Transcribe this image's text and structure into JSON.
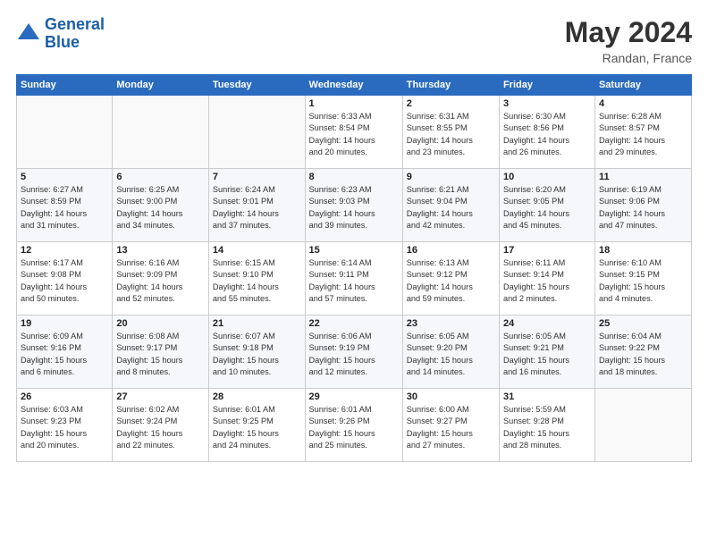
{
  "header": {
    "logo_line1": "General",
    "logo_line2": "Blue",
    "title": "May 2024",
    "subtitle": "Randan, France"
  },
  "weekdays": [
    "Sunday",
    "Monday",
    "Tuesday",
    "Wednesday",
    "Thursday",
    "Friday",
    "Saturday"
  ],
  "weeks": [
    [
      {
        "day": "",
        "info": ""
      },
      {
        "day": "",
        "info": ""
      },
      {
        "day": "",
        "info": ""
      },
      {
        "day": "1",
        "info": "Sunrise: 6:33 AM\nSunset: 8:54 PM\nDaylight: 14 hours\nand 20 minutes."
      },
      {
        "day": "2",
        "info": "Sunrise: 6:31 AM\nSunset: 8:55 PM\nDaylight: 14 hours\nand 23 minutes."
      },
      {
        "day": "3",
        "info": "Sunrise: 6:30 AM\nSunset: 8:56 PM\nDaylight: 14 hours\nand 26 minutes."
      },
      {
        "day": "4",
        "info": "Sunrise: 6:28 AM\nSunset: 8:57 PM\nDaylight: 14 hours\nand 29 minutes."
      }
    ],
    [
      {
        "day": "5",
        "info": "Sunrise: 6:27 AM\nSunset: 8:59 PM\nDaylight: 14 hours\nand 31 minutes."
      },
      {
        "day": "6",
        "info": "Sunrise: 6:25 AM\nSunset: 9:00 PM\nDaylight: 14 hours\nand 34 minutes."
      },
      {
        "day": "7",
        "info": "Sunrise: 6:24 AM\nSunset: 9:01 PM\nDaylight: 14 hours\nand 37 minutes."
      },
      {
        "day": "8",
        "info": "Sunrise: 6:23 AM\nSunset: 9:03 PM\nDaylight: 14 hours\nand 39 minutes."
      },
      {
        "day": "9",
        "info": "Sunrise: 6:21 AM\nSunset: 9:04 PM\nDaylight: 14 hours\nand 42 minutes."
      },
      {
        "day": "10",
        "info": "Sunrise: 6:20 AM\nSunset: 9:05 PM\nDaylight: 14 hours\nand 45 minutes."
      },
      {
        "day": "11",
        "info": "Sunrise: 6:19 AM\nSunset: 9:06 PM\nDaylight: 14 hours\nand 47 minutes."
      }
    ],
    [
      {
        "day": "12",
        "info": "Sunrise: 6:17 AM\nSunset: 9:08 PM\nDaylight: 14 hours\nand 50 minutes."
      },
      {
        "day": "13",
        "info": "Sunrise: 6:16 AM\nSunset: 9:09 PM\nDaylight: 14 hours\nand 52 minutes."
      },
      {
        "day": "14",
        "info": "Sunrise: 6:15 AM\nSunset: 9:10 PM\nDaylight: 14 hours\nand 55 minutes."
      },
      {
        "day": "15",
        "info": "Sunrise: 6:14 AM\nSunset: 9:11 PM\nDaylight: 14 hours\nand 57 minutes."
      },
      {
        "day": "16",
        "info": "Sunrise: 6:13 AM\nSunset: 9:12 PM\nDaylight: 14 hours\nand 59 minutes."
      },
      {
        "day": "17",
        "info": "Sunrise: 6:11 AM\nSunset: 9:14 PM\nDaylight: 15 hours\nand 2 minutes."
      },
      {
        "day": "18",
        "info": "Sunrise: 6:10 AM\nSunset: 9:15 PM\nDaylight: 15 hours\nand 4 minutes."
      }
    ],
    [
      {
        "day": "19",
        "info": "Sunrise: 6:09 AM\nSunset: 9:16 PM\nDaylight: 15 hours\nand 6 minutes."
      },
      {
        "day": "20",
        "info": "Sunrise: 6:08 AM\nSunset: 9:17 PM\nDaylight: 15 hours\nand 8 minutes."
      },
      {
        "day": "21",
        "info": "Sunrise: 6:07 AM\nSunset: 9:18 PM\nDaylight: 15 hours\nand 10 minutes."
      },
      {
        "day": "22",
        "info": "Sunrise: 6:06 AM\nSunset: 9:19 PM\nDaylight: 15 hours\nand 12 minutes."
      },
      {
        "day": "23",
        "info": "Sunrise: 6:05 AM\nSunset: 9:20 PM\nDaylight: 15 hours\nand 14 minutes."
      },
      {
        "day": "24",
        "info": "Sunrise: 6:05 AM\nSunset: 9:21 PM\nDaylight: 15 hours\nand 16 minutes."
      },
      {
        "day": "25",
        "info": "Sunrise: 6:04 AM\nSunset: 9:22 PM\nDaylight: 15 hours\nand 18 minutes."
      }
    ],
    [
      {
        "day": "26",
        "info": "Sunrise: 6:03 AM\nSunset: 9:23 PM\nDaylight: 15 hours\nand 20 minutes."
      },
      {
        "day": "27",
        "info": "Sunrise: 6:02 AM\nSunset: 9:24 PM\nDaylight: 15 hours\nand 22 minutes."
      },
      {
        "day": "28",
        "info": "Sunrise: 6:01 AM\nSunset: 9:25 PM\nDaylight: 15 hours\nand 24 minutes."
      },
      {
        "day": "29",
        "info": "Sunrise: 6:01 AM\nSunset: 9:26 PM\nDaylight: 15 hours\nand 25 minutes."
      },
      {
        "day": "30",
        "info": "Sunrise: 6:00 AM\nSunset: 9:27 PM\nDaylight: 15 hours\nand 27 minutes."
      },
      {
        "day": "31",
        "info": "Sunrise: 5:59 AM\nSunset: 9:28 PM\nDaylight: 15 hours\nand 28 minutes."
      },
      {
        "day": "",
        "info": ""
      }
    ]
  ]
}
